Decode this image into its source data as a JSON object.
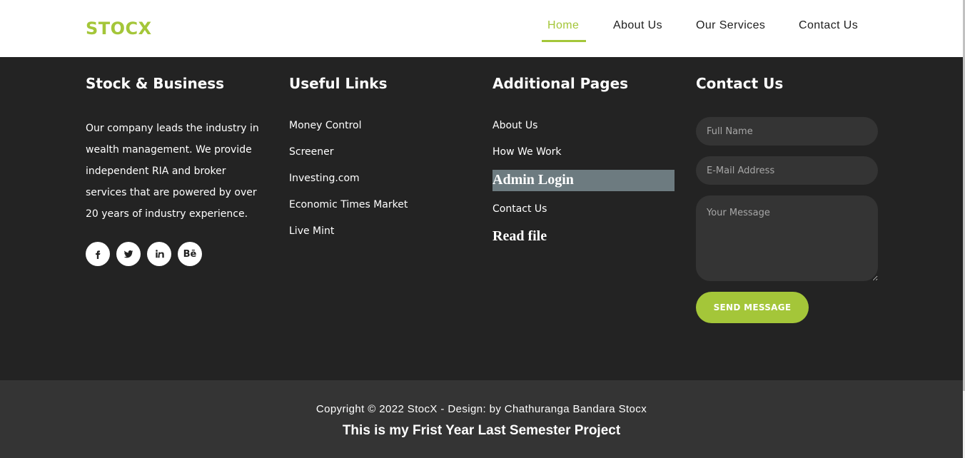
{
  "header": {
    "logo": "STOCX",
    "nav": [
      {
        "label": "Home",
        "active": true
      },
      {
        "label": "About Us",
        "active": false
      },
      {
        "label": "Our Services",
        "active": false
      },
      {
        "label": "Contact Us",
        "active": false
      }
    ]
  },
  "footer": {
    "about": {
      "title": "Stock & Business",
      "text": "Our company leads the industry in wealth management. We provide independent RIA and broker services that are powered by over 20 years of industry experience.",
      "social": [
        {
          "icon": "facebook-icon"
        },
        {
          "icon": "twitter-icon"
        },
        {
          "icon": "linkedin-icon"
        },
        {
          "icon": "behance-icon",
          "glyph": "Bē"
        }
      ]
    },
    "useful_links": {
      "title": "Useful Links",
      "items": [
        "Money Control",
        "Screener",
        "Investing.com",
        "Economic Times Market",
        "Live Mint"
      ]
    },
    "additional_pages": {
      "title": "Additional Pages",
      "items": [
        "About Us",
        "How We Work",
        "Admin Login",
        "Contact Us",
        "Read file"
      ]
    },
    "contact": {
      "title": "Contact Us",
      "name_placeholder": "Full Name",
      "email_placeholder": "E-Mail Address",
      "message_placeholder": "Your Message",
      "send_label": "SEND MESSAGE"
    }
  },
  "bottom": {
    "copyright": "Copyright © 2022 StocX - Design: by Chathuranga Bandara Stocx",
    "project_note": "This is my Frist Year Last Semester Project"
  },
  "colors": {
    "accent": "#a4c639",
    "footer_bg": "#232323",
    "bottom_bg": "#343434",
    "highlight_bg": "#6d7b80"
  }
}
